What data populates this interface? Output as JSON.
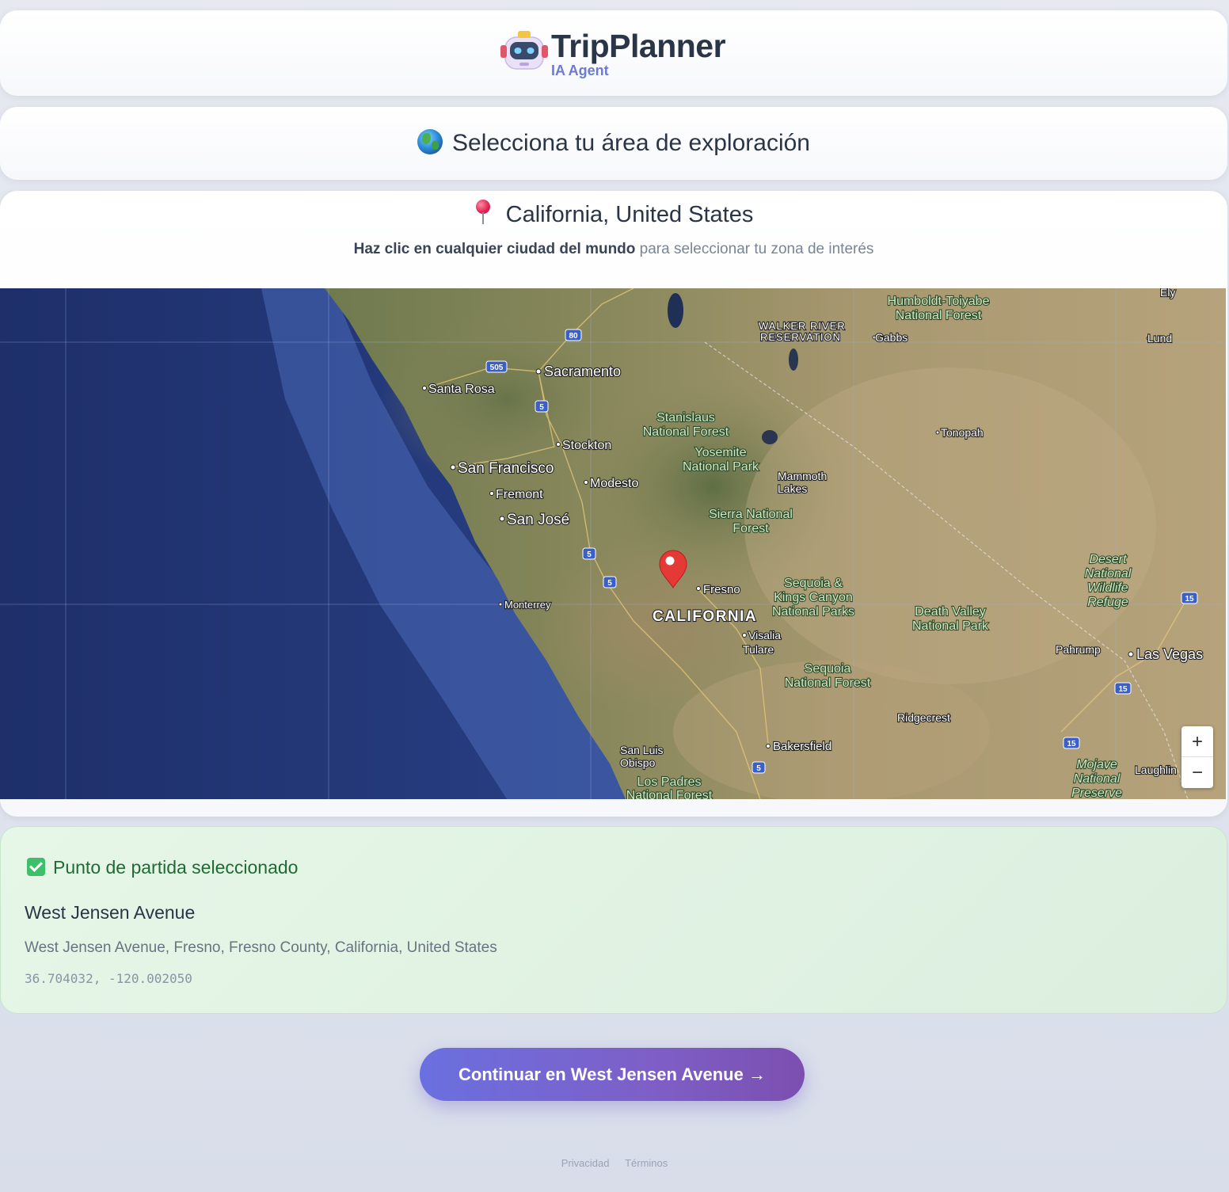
{
  "header": {
    "title": "TripPlanner",
    "subtitle": "IA Agent",
    "logo_icon": "robot-icon"
  },
  "explore": {
    "title": "Selecciona tu área de exploración",
    "icon": "globe-icon"
  },
  "location": {
    "title": "California, United States",
    "hint_bold": "Haz clic en cualquier ciudad del mundo",
    "hint_rest": "para seleccionar tu zona de interés"
  },
  "map": {
    "cities": {
      "sacramento": "Sacramento",
      "santa_rosa": "Santa Rosa",
      "stockton": "Stockton",
      "san_francisco": "San Francisco",
      "modesto": "Modesto",
      "fremont": "Fremont",
      "san_jose": "San José",
      "monterrey": "Monterrey",
      "fresno": "Fresno",
      "california": "CALIFORNIA",
      "visalia": "Visalia",
      "tulare": "Tulare",
      "bakersfield": "Bakersfield",
      "slo_1": "San Luis",
      "slo_2": "Obispo",
      "ridgecrest": "Ridgecrest",
      "pahrump": "Pahrump",
      "las_vegas": "Las Vegas",
      "tonopah": "Tonopah",
      "gabbs": "Gabbs",
      "lund": "Lund",
      "ely": "Ely",
      "laughlin": "Laughlin",
      "walker_1": "WALKER RIVER",
      "walker_2": "RESERVATION",
      "mammoth_1": "Mammoth",
      "mammoth_2": "Lakes"
    },
    "parks": {
      "humboldt_1": "Humboldt-Toiyabe",
      "humboldt_2": "National Forest",
      "stanislaus_1": "Stanislaus",
      "stanislaus_2": "National Forest",
      "yosemite_1": "Yosemite",
      "yosemite_2": "National Park",
      "sierra_1": "Sierra National",
      "sierra_2": "Forest",
      "sequoia_kings_1": "Sequoia &",
      "sequoia_kings_2": "Kings Canyon",
      "sequoia_kings_3": "National Parks",
      "sequoia_nf_1": "Sequoia",
      "sequoia_nf_2": "National Forest",
      "death_valley_1": "Death Valley",
      "death_valley_2": "National Park",
      "desert_1": "Desert",
      "desert_2": "National",
      "desert_3": "Wildlife",
      "desert_4": "Refuge",
      "mojave_1": "Mojave",
      "mojave_2": "National",
      "mojave_3": "Preserve",
      "los_padres_1": "Los Padres",
      "los_padres_2": "National Forest"
    },
    "shields": [
      "80",
      "505",
      "5",
      "5",
      "5",
      "5",
      "15",
      "15",
      "15"
    ],
    "zoom_in": "+",
    "zoom_out": "−"
  },
  "selected": {
    "heading": "Punto de partida seleccionado",
    "name": "West Jensen Avenue",
    "address": "West Jensen Avenue, Fresno, Fresno County, California, United States",
    "coords": "36.704032, -120.002050"
  },
  "cta": {
    "label": "Continuar en West Jensen Avenue →"
  },
  "footer": {
    "privacy": "Privacidad",
    "terms": "Términos"
  },
  "colors": {
    "accent": "#6a70e0",
    "success_bg": "#e2f4e4",
    "success_text": "#1f6b34",
    "pin": "#e53935"
  }
}
